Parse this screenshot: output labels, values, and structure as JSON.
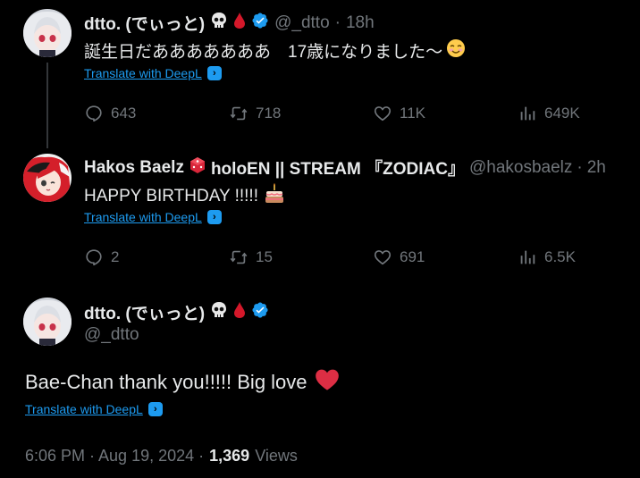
{
  "tweet1": {
    "display_name": "dtto. (でぃっと)",
    "handle": "@_dtto",
    "separator": "·",
    "time": "18h",
    "text": "誕生日だあああああああ　17歳になりました〜",
    "translate": "Translate with DeepL",
    "replies": "643",
    "reposts": "718",
    "likes": "11K",
    "views": "649K"
  },
  "tweet2": {
    "display_name": "Hakos Baelz",
    "display_name_suffix": "holoEN || STREAM 『ZODIAC』",
    "handle": "@hakosbaelz",
    "separator": "·",
    "time": "2h",
    "text": "HAPPY BIRTHDAY !!!!!",
    "translate": "Translate with DeepL",
    "replies": "2",
    "reposts": "15",
    "likes": "691",
    "views": "6.5K"
  },
  "main_tweet": {
    "display_name": "dtto. (でぃっと)",
    "handle": "@_dtto",
    "text": "Bae-Chan thank you!!!!! Big love",
    "translate": "Translate with DeepL",
    "timestamp": "6:06 PM · Aug 19, 2024 ·",
    "view_count": "1,369",
    "views_label": "Views"
  },
  "colors": {
    "background": "#000000",
    "text": "#e7e9ea",
    "muted": "#71767b",
    "link": "#1d9bf0",
    "verified": "#1d9bf0",
    "heart": "#f91880"
  },
  "icons": {
    "reply": "reply-icon",
    "repost": "repost-icon",
    "like": "heart-icon",
    "views": "analytics-icon",
    "verified": "verified-badge-icon",
    "deepl": "deepl-icon"
  }
}
